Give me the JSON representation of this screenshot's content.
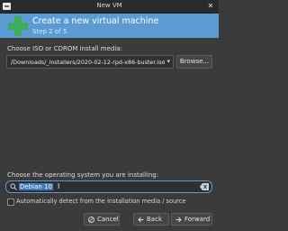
{
  "window": {
    "title": "New VM"
  },
  "header": {
    "title": "Create a new virtual machine",
    "step": "Step 2 of 5"
  },
  "install_media": {
    "label": "Choose ISO or CDROM install media:",
    "path": "/Downloads/_installers/2020-02-12-rpd-x86-buster.iso",
    "browse_label": "Browse..."
  },
  "os": {
    "label": "Choose the operating system you are installing:",
    "value": "Debian 10",
    "auto_detect_label": "Automatically detect from the installation media / source",
    "auto_detect_checked": false
  },
  "buttons": {
    "cancel": "Cancel",
    "back": "Back",
    "forward": "Forward"
  },
  "colors": {
    "header_bg": "#5a9bd4",
    "plus_icon": "#3fae58",
    "focus_border": "#5a9bd4",
    "selection": "#3f79b8"
  }
}
